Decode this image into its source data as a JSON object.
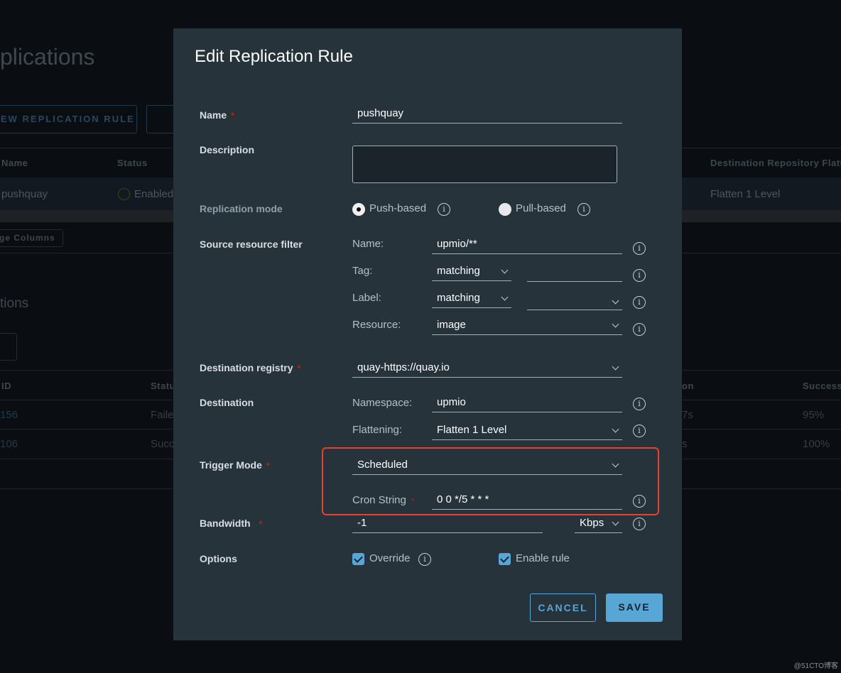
{
  "background": {
    "page_title": "plications",
    "new_rule_button": "EW REPLICATION RULE",
    "rules_table": {
      "headers": [
        "Name",
        "Status",
        "Destination Repository Flatte"
      ],
      "row": {
        "name": "pushquay",
        "status": "Enabled",
        "flattening": "Flatten 1 Level"
      }
    },
    "manage_columns": "ge Columns",
    "executions_title": "tions",
    "executions_table": {
      "headers": [
        "ID",
        "Statu",
        "on",
        "Success"
      ],
      "rows": [
        {
          "id": "156",
          "status": "Faile",
          "duration": "7s",
          "success": "95%"
        },
        {
          "id": "106",
          "status": "Succ",
          "duration": "s",
          "success": "100%"
        }
      ]
    }
  },
  "modal": {
    "title": "Edit Replication Rule",
    "name": {
      "label": "Name",
      "value": "pushquay"
    },
    "description": {
      "label": "Description",
      "value": ""
    },
    "replication_mode": {
      "label": "Replication mode",
      "options": [
        "Push-based",
        "Pull-based"
      ],
      "selected": "Push-based"
    },
    "source_filter": {
      "label": "Source resource filter",
      "name": {
        "label": "Name:",
        "value": "upmio/**"
      },
      "tag": {
        "label": "Tag:",
        "match": "matching",
        "value": ""
      },
      "label_filter": {
        "label": "Label:",
        "match": "matching",
        "value": ""
      },
      "resource": {
        "label": "Resource:",
        "value": "image"
      }
    },
    "destination_registry": {
      "label": "Destination registry",
      "value": "quay-https://quay.io"
    },
    "destination": {
      "label": "Destination",
      "namespace_label": "Namespace:",
      "namespace": "upmio",
      "flattening_label": "Flattening:",
      "flattening": "Flatten 1 Level"
    },
    "trigger_mode": {
      "label": "Trigger Mode",
      "value": "Scheduled",
      "cron_label": "Cron String",
      "cron": "0 0 */5 * * *"
    },
    "bandwidth": {
      "label": "Bandwidth",
      "value": "-1",
      "unit": "Kbps"
    },
    "options": {
      "label": "Options",
      "override": "Override",
      "override_checked": true,
      "enable_rule": "Enable rule",
      "enable_rule_checked": true
    },
    "cancel": "CANCEL",
    "save": "SAVE"
  },
  "highlight_color": "#e8412e",
  "accent_color": "#57a6d6",
  "watermark": "@51CTO博客"
}
